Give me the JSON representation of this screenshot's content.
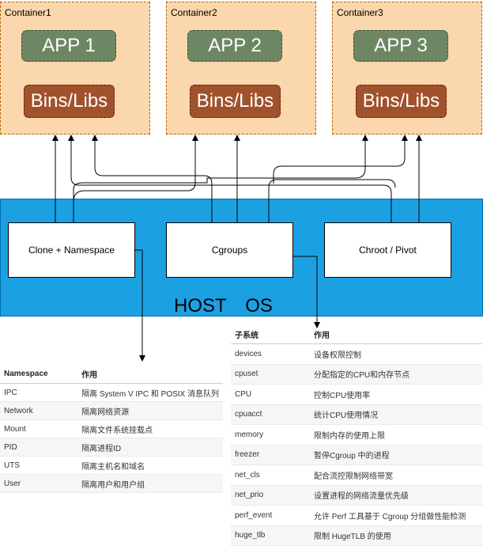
{
  "containers": [
    {
      "label": "Container1",
      "app": "APP 1",
      "libs": "Bins/Libs"
    },
    {
      "label": "Container2",
      "app": "APP 2",
      "libs": "Bins/Libs"
    },
    {
      "label": "Container3",
      "app": "APP 3",
      "libs": "Bins/Libs"
    }
  ],
  "host": {
    "label": "HOST　OS",
    "boxes": [
      "Clone + Namespace",
      "Cgroups",
      "Chroot / Pivot"
    ]
  },
  "namespace_table": {
    "headers": [
      "Namespace",
      "作用"
    ],
    "rows": [
      [
        "IPC",
        "隔离 System V IPC 和 POSIX 消息队列"
      ],
      [
        "Network",
        "隔离网络资源"
      ],
      [
        "Mount",
        "隔离文件系统挂载点"
      ],
      [
        "PID",
        "隔离进程ID"
      ],
      [
        "UTS",
        "隔离主机名和域名"
      ],
      [
        "User",
        "隔离用户和用户组"
      ]
    ]
  },
  "cgroup_table": {
    "headers": [
      "子系统",
      "作用"
    ],
    "rows": [
      [
        "devices",
        "设备权限控制"
      ],
      [
        "cpuset",
        "分配指定的CPU和内存节点"
      ],
      [
        "CPU",
        "控制CPU使用率"
      ],
      [
        "cpuacct",
        "统计CPU使用情况"
      ],
      [
        "memory",
        "限制内存的使用上限"
      ],
      [
        "freezer",
        "暂停Cgroup 中的进程"
      ],
      [
        "net_cls",
        "配合流控限制网络带宽"
      ],
      [
        "net_prio",
        "设置进程的网络流量优先级"
      ],
      [
        "perf_event",
        "允许 Perf 工具基于 Cgroup 分组做性能检测"
      ],
      [
        "huge_tlb",
        "限制 HugeTLB 的使用"
      ]
    ]
  }
}
